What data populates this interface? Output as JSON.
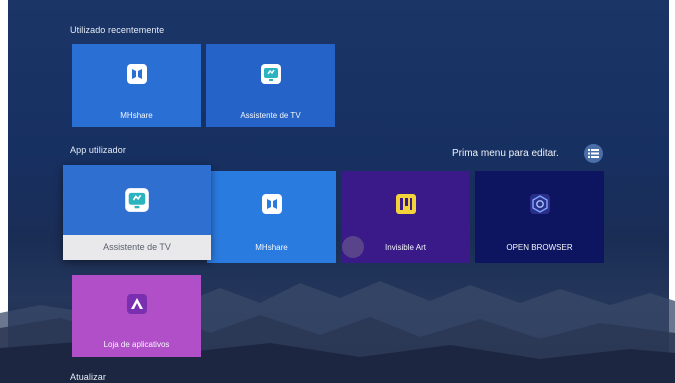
{
  "sections": {
    "recent_title": "Utilizado recentemente",
    "user_apps_title": "App utilizador",
    "update_title": "Atualizar"
  },
  "hint": {
    "text": "Prima menu para editar."
  },
  "recent": [
    {
      "label": "MHshare",
      "icon": "mhshare-icon",
      "color": "#2a6fd4"
    },
    {
      "label": "Assistente de TV",
      "icon": "tv-assistant-icon",
      "color": "#2563c8"
    }
  ],
  "apps": [
    {
      "label": "Assistente de TV",
      "icon": "tv-assistant-icon",
      "color": "#2e6fd0",
      "focused": true
    },
    {
      "label": "MHshare",
      "icon": "mhshare-icon",
      "color": "#2a7be0"
    },
    {
      "label": "Invisible Art",
      "icon": "invisible-art-icon",
      "color": "#3a1a88"
    },
    {
      "label": "OPEN BROWSER",
      "icon": "open-browser-icon",
      "color": "#0e1560"
    },
    {
      "label": "Loja de aplicativos",
      "icon": "app-store-icon",
      "color": "#b14fc8"
    }
  ],
  "colors": {
    "accent": "#2a6fd4",
    "focused_label_bg": "#e9e9ec"
  }
}
